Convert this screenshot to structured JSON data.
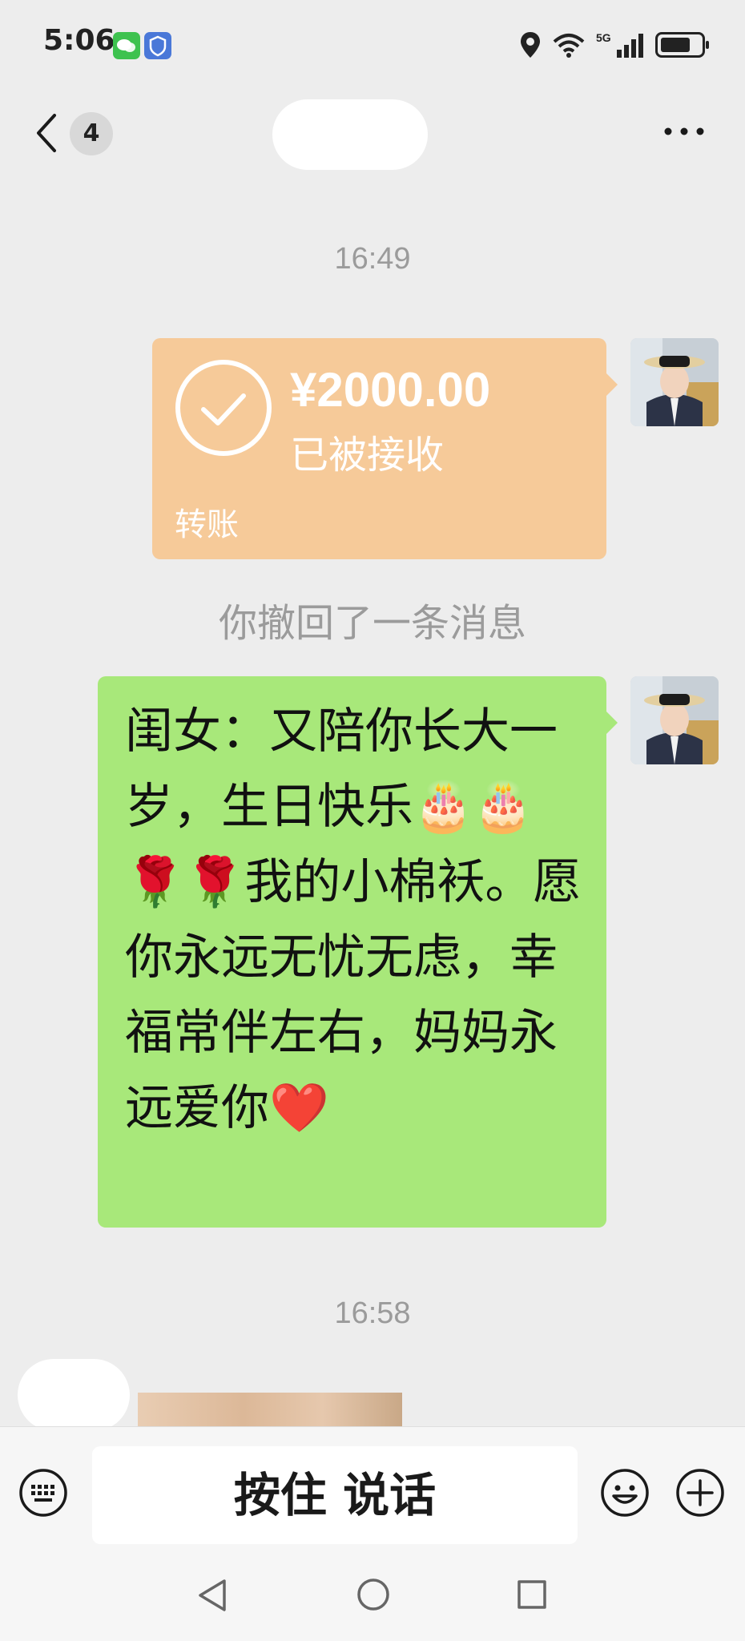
{
  "status_bar": {
    "time": "5:06"
  },
  "header": {
    "unread_count": "4"
  },
  "messages": {
    "timestamp_1": "16:49",
    "transfer": {
      "amount": "¥2000.00",
      "status": "已被接收",
      "label": "转账",
      "color": "#f6ca99"
    },
    "recall_notice": "你撤回了一条消息",
    "text_message": "闺女：又陪你长大一岁，生日快乐🎂🎂🌹🌹我的小棉袄。愿你永远无忧无虑，幸福常伴左右，妈妈永远爱你❤️",
    "timestamp_2": "16:58"
  },
  "input_bar": {
    "talk_label": "按住 说话"
  },
  "colors": {
    "outgoing_bubble": "#a8e87a",
    "background": "#ededed"
  }
}
